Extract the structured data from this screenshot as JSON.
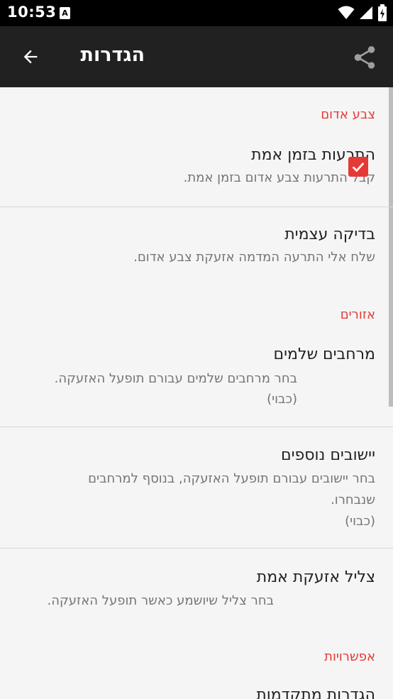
{
  "status_bar": {
    "time": "10:53",
    "notification_glyph": "A",
    "icons": [
      "wifi-icon",
      "signal-icon",
      "battery-charging-icon"
    ]
  },
  "app_bar": {
    "title": "הגדרות",
    "back_icon": "arrow-back-icon",
    "share_icon": "share-icon"
  },
  "accent_color": "#e53935",
  "sections": {
    "red_alert": {
      "header": "צבע אדום",
      "realtime": {
        "title": "התרעות בזמן אמת",
        "summary": "קבל התרעות צבע אדום בזמן אמת.",
        "checked": true
      },
      "self_test": {
        "title": "בדיקה עצמית",
        "summary": "שלח אלי התרעה המדמה אזעקת צבע אדום."
      }
    },
    "areas": {
      "header": "אזורים",
      "regions": {
        "title": "מרחבים שלמים",
        "summary_line1": "בחר מרחבים שלמים עבורם תופעל האזעקה.",
        "summary_line2": "(כבוי)"
      },
      "cities": {
        "title": "יישובים נוספים",
        "summary_line1": "בחר יישובים עבורם תופעל האזעקה, בנוסף למרחבים",
        "summary_line2": "שנבחרו.",
        "summary_line3": "(כבוי)"
      },
      "sound": {
        "title": "צליל אזעקת אמת",
        "summary": "בחר צליל שיושמע כאשר תופעל האזעקה."
      }
    },
    "options": {
      "header": "אפשרויות",
      "advanced": {
        "title": "הגדרות מתקדמות"
      }
    }
  }
}
